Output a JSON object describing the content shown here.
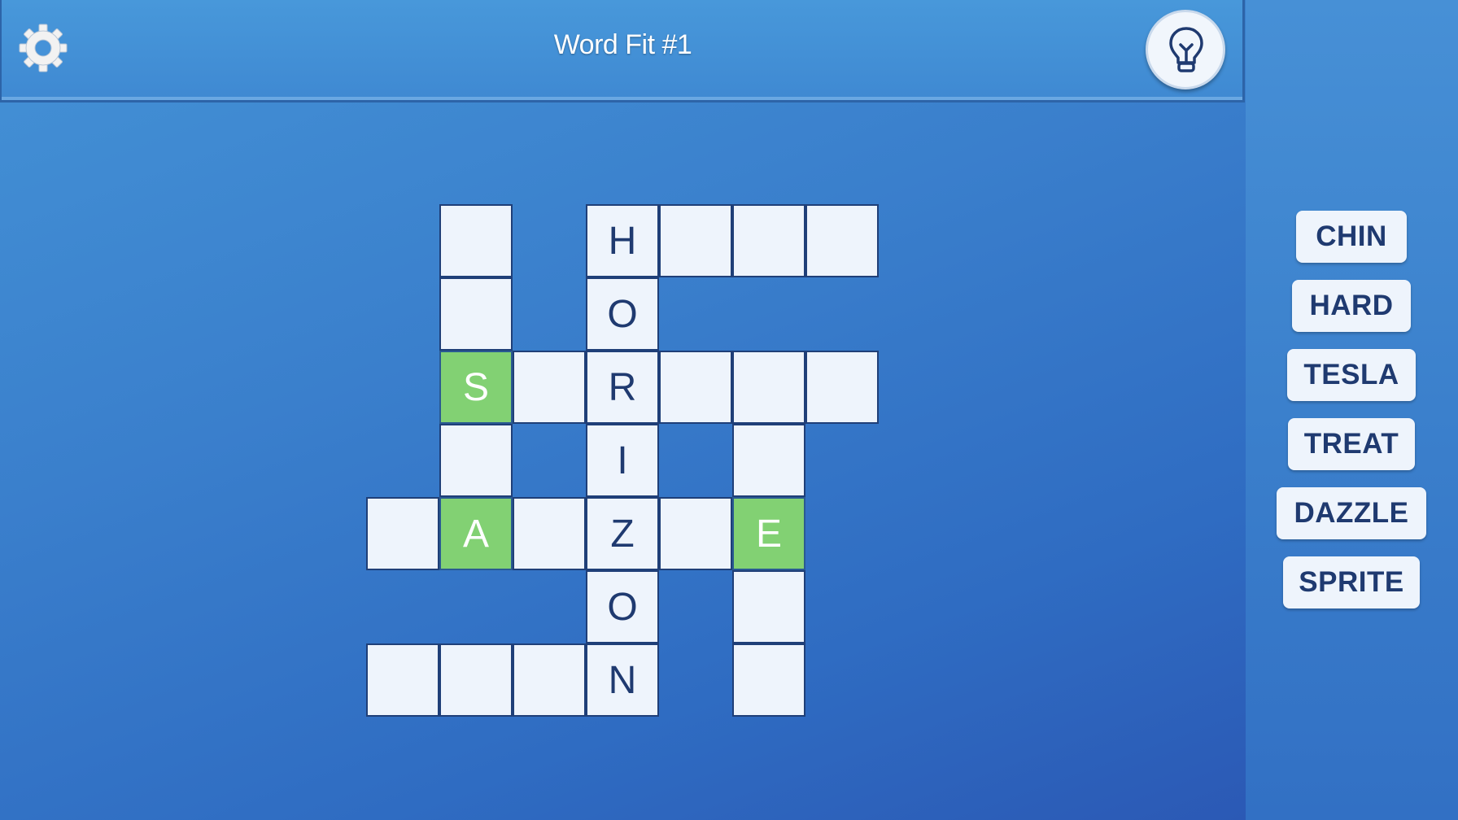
{
  "header": {
    "title": "Word Fit #1",
    "settings_icon": "gear-icon",
    "hint_icon": "lightbulb-icon"
  },
  "colors": {
    "background": "#3f87d1",
    "cell": "#eef4fc",
    "cell_border": "#1f3f78",
    "cell_revealed": "#82d173",
    "letter": "#1f3a70"
  },
  "grid": {
    "rows": 7,
    "cols": 7,
    "cells": [
      {
        "row": 0,
        "col": 1,
        "letter": "",
        "revealed": false
      },
      {
        "row": 0,
        "col": 3,
        "letter": "H",
        "revealed": false
      },
      {
        "row": 0,
        "col": 4,
        "letter": "",
        "revealed": false
      },
      {
        "row": 0,
        "col": 5,
        "letter": "",
        "revealed": false
      },
      {
        "row": 0,
        "col": 6,
        "letter": "",
        "revealed": false
      },
      {
        "row": 1,
        "col": 1,
        "letter": "",
        "revealed": false
      },
      {
        "row": 1,
        "col": 3,
        "letter": "O",
        "revealed": false
      },
      {
        "row": 2,
        "col": 1,
        "letter": "S",
        "revealed": true
      },
      {
        "row": 2,
        "col": 2,
        "letter": "",
        "revealed": false
      },
      {
        "row": 2,
        "col": 3,
        "letter": "R",
        "revealed": false
      },
      {
        "row": 2,
        "col": 4,
        "letter": "",
        "revealed": false
      },
      {
        "row": 2,
        "col": 5,
        "letter": "",
        "revealed": false
      },
      {
        "row": 2,
        "col": 6,
        "letter": "",
        "revealed": false
      },
      {
        "row": 3,
        "col": 1,
        "letter": "",
        "revealed": false
      },
      {
        "row": 3,
        "col": 3,
        "letter": "I",
        "revealed": false
      },
      {
        "row": 3,
        "col": 5,
        "letter": "",
        "revealed": false
      },
      {
        "row": 4,
        "col": 0,
        "letter": "",
        "revealed": false
      },
      {
        "row": 4,
        "col": 1,
        "letter": "A",
        "revealed": true
      },
      {
        "row": 4,
        "col": 2,
        "letter": "",
        "revealed": false
      },
      {
        "row": 4,
        "col": 3,
        "letter": "Z",
        "revealed": false
      },
      {
        "row": 4,
        "col": 4,
        "letter": "",
        "revealed": false
      },
      {
        "row": 4,
        "col": 5,
        "letter": "E",
        "revealed": true
      },
      {
        "row": 5,
        "col": 3,
        "letter": "O",
        "revealed": false
      },
      {
        "row": 5,
        "col": 5,
        "letter": "",
        "revealed": false
      },
      {
        "row": 6,
        "col": 0,
        "letter": "",
        "revealed": false
      },
      {
        "row": 6,
        "col": 1,
        "letter": "",
        "revealed": false
      },
      {
        "row": 6,
        "col": 2,
        "letter": "",
        "revealed": false
      },
      {
        "row": 6,
        "col": 3,
        "letter": "N",
        "revealed": false
      },
      {
        "row": 6,
        "col": 5,
        "letter": "",
        "revealed": false
      }
    ]
  },
  "word_bank": {
    "words": [
      "CHIN",
      "HARD",
      "TESLA",
      "TREAT",
      "DAZZLE",
      "SPRITE"
    ]
  }
}
